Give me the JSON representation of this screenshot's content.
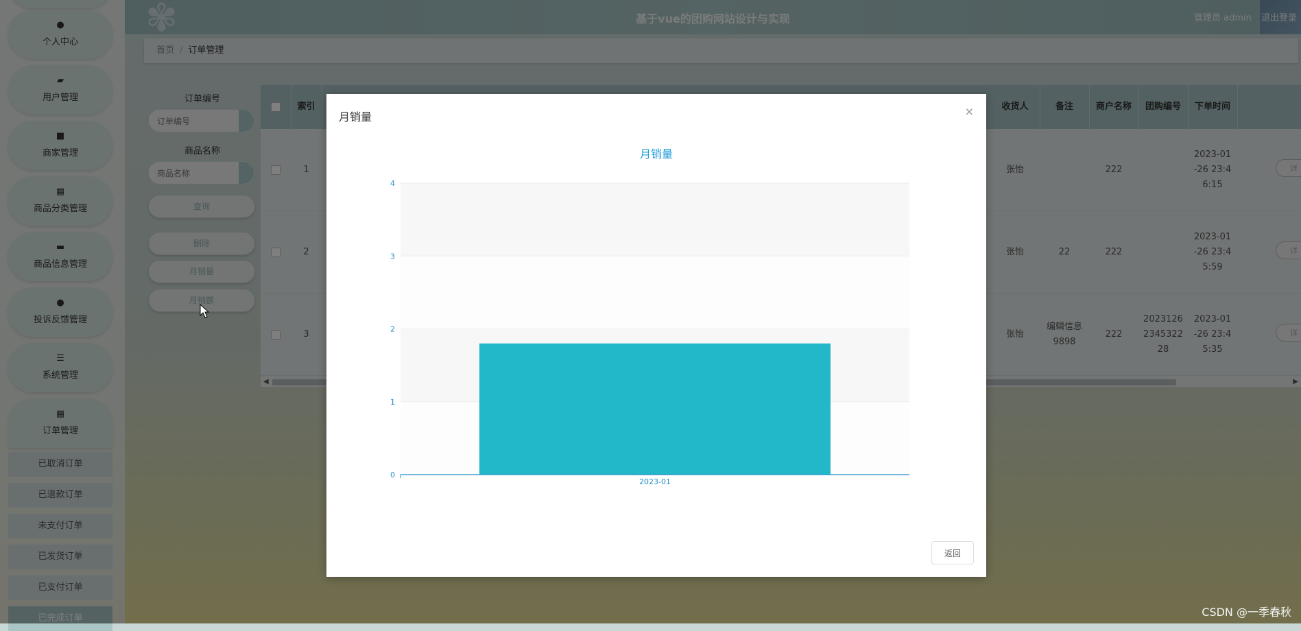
{
  "header": {
    "title": "基于vue的团购网站设计与实现",
    "user": "管理员 admin",
    "logout": "退出登录"
  },
  "sidebar": {
    "items": [
      {
        "label": "个人中心",
        "icon": "user-icon"
      },
      {
        "label": "用户管理",
        "icon": "user-edit-icon"
      },
      {
        "label": "商家管理",
        "icon": "store-icon"
      },
      {
        "label": "商品分类管理",
        "icon": "grid-icon"
      },
      {
        "label": "商品信息管理",
        "icon": "briefcase-icon"
      },
      {
        "label": "投诉反馈管理",
        "icon": "person-icon"
      },
      {
        "label": "系统管理",
        "icon": "sliders-icon"
      },
      {
        "label": "订单管理",
        "icon": "grid-icon"
      }
    ],
    "order_sub": [
      "已取消订单",
      "已退款订单",
      "未支付订单",
      "已发货订单",
      "已支付订单",
      "已完成订单"
    ]
  },
  "breadcrumb": {
    "home": "首页",
    "sep": "/",
    "current": "订单管理"
  },
  "search": {
    "order_no_label": "订单编号",
    "order_no_placeholder": "订单编号",
    "goods_name_label": "商品名称",
    "goods_name_placeholder": "商品名称",
    "query": "查询",
    "delete": "删除",
    "monthly_sales": "月销量",
    "monthly_revenue": "月销额"
  },
  "table": {
    "headers": {
      "index": "索引",
      "receiver": "收货人",
      "remark": "备注",
      "merchant": "商户名称",
      "group_no": "团购编号",
      "order_time": "下单时间"
    },
    "rows": [
      {
        "index": "1",
        "receiver": "张怡",
        "remark": "",
        "merchant": "222",
        "group_no": "",
        "time": [
          "2023-01",
          "-26 23:4",
          "6:15"
        ],
        "action": "详"
      },
      {
        "index": "2",
        "receiver": "张怡",
        "remark": "22",
        "merchant": "222",
        "group_no": "",
        "time": [
          "2023-01",
          "-26 23:4",
          "5:59"
        ],
        "action": "详"
      },
      {
        "index": "3",
        "receiver": "张怡",
        "remark": [
          "编辑信息",
          "9898"
        ],
        "merchant": "222",
        "group_no": [
          "2023126",
          "2345322",
          "28"
        ],
        "time": [
          "2023-01",
          "-26 23:4",
          "5:35"
        ],
        "action": "详"
      }
    ]
  },
  "dialog": {
    "title": "月销量",
    "close": "×",
    "back": "返回"
  },
  "chart_data": {
    "type": "bar",
    "title": "月销量",
    "categories": [
      "2023-01"
    ],
    "values": [
      1.8
    ],
    "ylim": [
      0,
      4
    ],
    "yticks": [
      0,
      1,
      2,
      3,
      4
    ],
    "color": "#22b7c9",
    "title_color": "#1f9bd7",
    "band_color": "#f7f7f7",
    "axis_color": "#1f8fc6"
  },
  "watermark": "CSDN @一季春秋"
}
